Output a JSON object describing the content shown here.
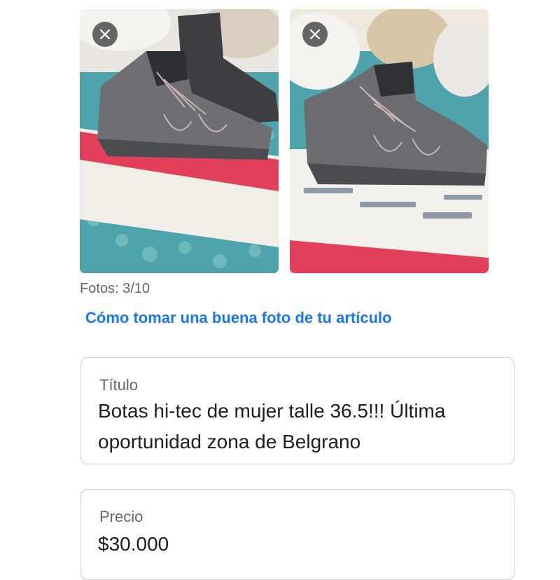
{
  "photos": [
    {
      "label": "boot-photo-1",
      "remove_icon": "close-icon"
    },
    {
      "label": "boot-photo-2",
      "remove_icon": "close-icon"
    }
  ],
  "photo_count": "Fotos: 3/10",
  "help_link": "Cómo tomar una buena foto de tu artículo",
  "title_field": {
    "label": "Título",
    "line1": "Botas hi-tec de mujer talle 36.5!!! Última",
    "line2": "oportunidad zona de Belgrano"
  },
  "price_field": {
    "label": "Precio",
    "value": "$30.000"
  },
  "colors": {
    "link": "#1877f2",
    "secondary_text": "#65676b",
    "border": "#ced0d4"
  }
}
